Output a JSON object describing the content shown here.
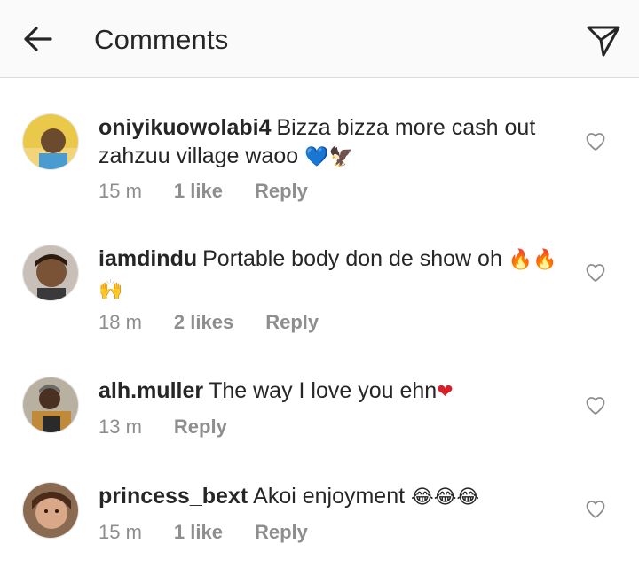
{
  "header": {
    "title": "Comments",
    "back_icon": "arrow-left-icon",
    "send_icon": "paper-plane-icon"
  },
  "comments": [
    {
      "username": "oniyikuowolabi4",
      "text": "Bizza bizza more cash out zahzuu village waoo",
      "emoji": "💙🦅",
      "time": "15 m",
      "likes": "1 like",
      "reply": "Reply"
    },
    {
      "username": "iamdindu",
      "text": "Portable body don de show oh",
      "emoji": "🔥🔥🙌",
      "time": "18 m",
      "likes": "2 likes",
      "reply": "Reply"
    },
    {
      "username": "alh.muller",
      "text": "The way I love you ehn",
      "emoji": "❤",
      "time": "13 m",
      "likes": "",
      "reply": "Reply"
    },
    {
      "username": "princess_bext",
      "text": "Akoi enjoyment",
      "emoji": "😂😂😂",
      "time": "15 m",
      "likes": "1 like",
      "reply": "Reply"
    }
  ],
  "colors": {
    "header_bg": "#fafafa",
    "text": "#262626",
    "meta": "#8e8e8e",
    "divider": "#dbdbdb"
  }
}
